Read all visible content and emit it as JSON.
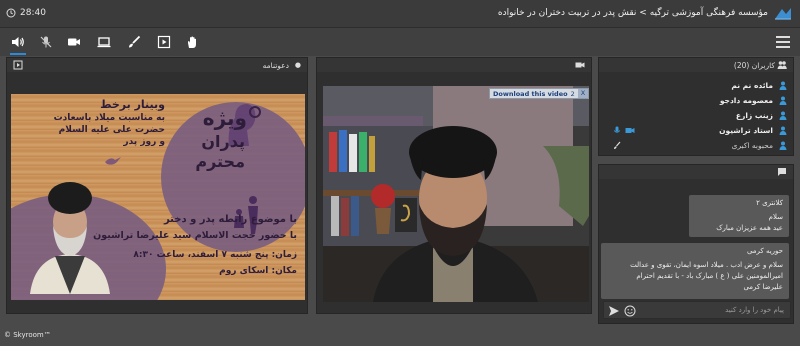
{
  "header": {
    "title": "مؤسسه فرهنگی آموزشی ترگیه > نقش پدر در تربیت دختران در خانواده",
    "timer": "28:40"
  },
  "toolbar": {
    "icons": [
      "speaker-icon",
      "mic-off-icon",
      "camera-icon",
      "screen-share-icon",
      "brush-icon",
      "media-icon",
      "raise-hand-icon"
    ],
    "active": "speaker-icon"
  },
  "doc_panel": {
    "title": "دعوتنامه",
    "poster": {
      "line1": "وبینار برخط",
      "line2": "به مناسبت میلاد باسعادت",
      "line3": "حضرت علی علیه السلام",
      "line4": "و روز پدر",
      "brand1": "ویژه",
      "brand2": "پدران",
      "brand3": "محترم",
      "topic": "با موضوع رابطه پدر و دختر",
      "host": "با حضور حجت الاسلام سید علیرضا تراشیون",
      "time": "زمان: پنج شنبه ۷ اسفند، ساعت ۸:۳۰",
      "place": "مکان: اسکای روم"
    }
  },
  "video_panel": {
    "download_label": "Download this video",
    "download_count": "2",
    "close": "X"
  },
  "users_panel": {
    "title": "کاربران (20)",
    "users": [
      {
        "name": "مائده نم نم",
        "mic": false,
        "cam": false
      },
      {
        "name": "معصومه دادجو",
        "mic": false,
        "cam": false
      },
      {
        "name": "زینب زارع",
        "mic": false,
        "cam": false
      },
      {
        "name": "استاد تراشیون",
        "mic": true,
        "cam": true
      },
      {
        "name": "محبوبه اکبری",
        "mic": false,
        "cam": false
      }
    ]
  },
  "chat_panel": {
    "messages": [
      {
        "name": "کلانتری ۲",
        "lines": [
          "سلام",
          "عید همه عزیزان مبارک"
        ]
      },
      {
        "name": "حوریه کرمی",
        "lines": [
          "سلام و عرض ادب . میلاد اسوه ایمان، تقوی و عدالت",
          "امیرالمومنین علی ( ع ) مبارک باد - با تقدیم احترام",
          "علیرضا کرمی"
        ]
      }
    ],
    "placeholder": "پیام خود را وارد کنید"
  },
  "footer": {
    "brand": "© Skyroom™"
  },
  "colors": {
    "accent": "#2b8bd8",
    "panel_bg": "#2f2f2f",
    "app_bg": "#4a4a4a",
    "poster_purple": "#7b5e7f"
  }
}
